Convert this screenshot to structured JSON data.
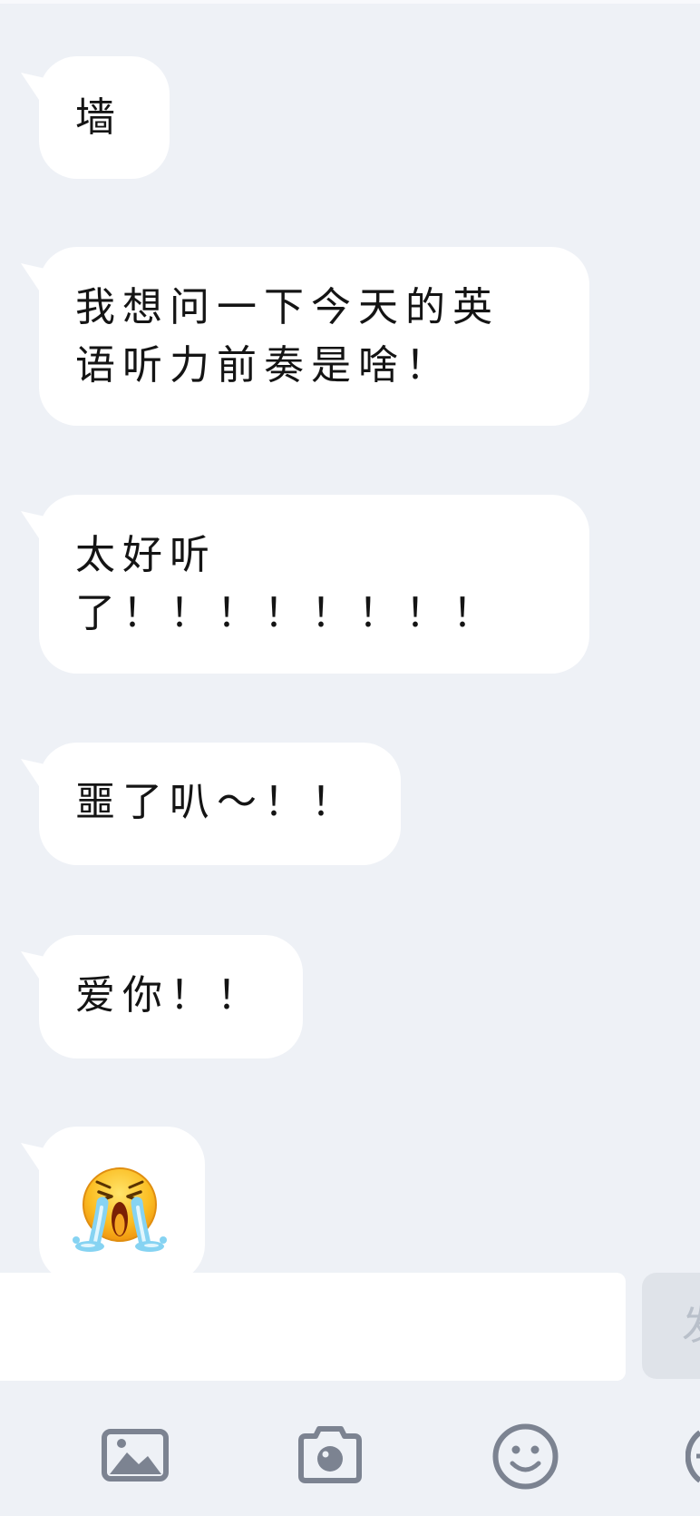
{
  "messages": [
    {
      "type": "text",
      "lines": [
        "墙"
      ]
    },
    {
      "type": "text",
      "lines": [
        "我想问一下今天的英",
        "语听力前奏是啥！"
      ]
    },
    {
      "type": "text",
      "lines": [
        "太好听",
        "了！！！！！！！！"
      ]
    },
    {
      "type": "text",
      "lines": [
        "噩了叭～！！"
      ]
    },
    {
      "type": "text",
      "lines": [
        "爱你！！"
      ]
    },
    {
      "type": "emoji",
      "icon": "crying-emoji-icon"
    }
  ],
  "input": {
    "value": ""
  },
  "send_button": {
    "label": "发"
  },
  "toolbar": {
    "items": [
      {
        "icon": "image-icon"
      },
      {
        "icon": "camera-icon"
      },
      {
        "icon": "smiley-icon"
      },
      {
        "icon": "more-icon"
      }
    ]
  },
  "colors": {
    "background": "#eef1f6",
    "bubble": "#ffffff",
    "text": "#141414",
    "icon": "#7c8391",
    "send_button": "#dfe3e9"
  }
}
